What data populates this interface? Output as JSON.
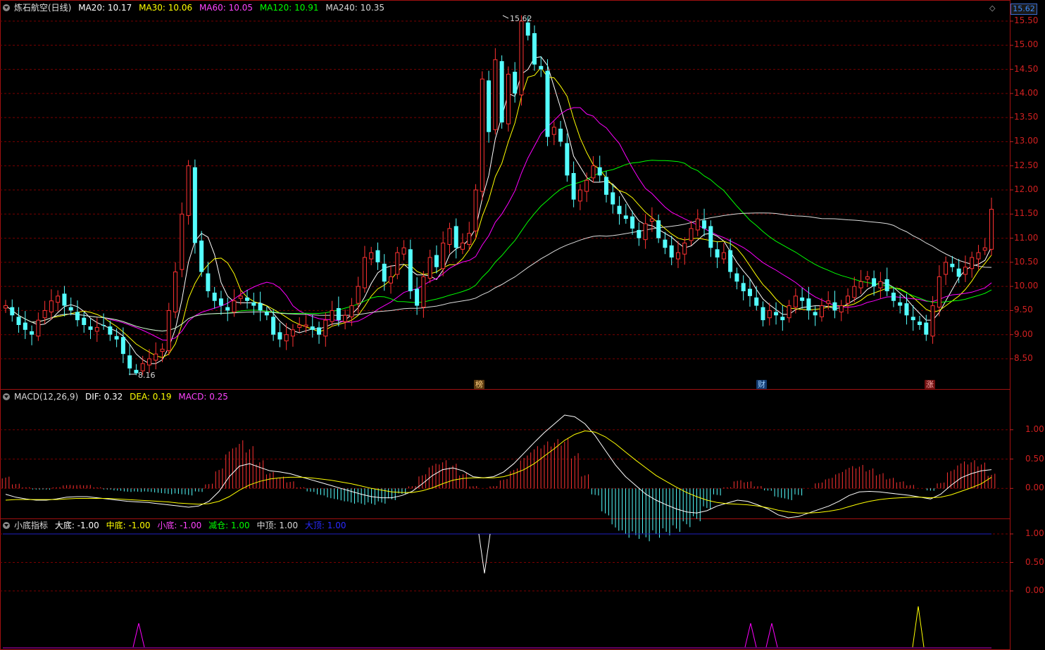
{
  "price_panel": {
    "title": "炼石航空(日线)",
    "ma": [
      {
        "label": "MA20: 10.17",
        "color": "#ffffff"
      },
      {
        "label": "MA30: 10.06",
        "color": "#ffff00"
      },
      {
        "label": "MA60: 10.05",
        "color": "#ff00ff"
      },
      {
        "label": "MA120: 10.91",
        "color": "#00ff00"
      },
      {
        "label": "MA240: 10.35",
        "color": "#dddddd"
      }
    ],
    "current_price": "15.62",
    "high_label": "15.62",
    "low_label": "8.16",
    "markers": [
      {
        "text": "榜",
        "bg": "#5a3a10",
        "color": "#ffd080"
      },
      {
        "text": "财",
        "bg": "#123a70",
        "color": "#9fd0ff"
      },
      {
        "text": "涨",
        "bg": "#701010",
        "color": "#ffb0b0"
      }
    ]
  },
  "macd_panel": {
    "name": "MACD(12,26,9)",
    "dif": "DIF: 0.32",
    "dea": "DEA: 0.19",
    "macd": "MACD: 0.25"
  },
  "bottom_panel": {
    "name": "小底指标",
    "items": [
      {
        "label": "大底: -1.00",
        "color": "#ffffff"
      },
      {
        "label": "中底: -1.00",
        "color": "#ffff00"
      },
      {
        "label": "小底: -1.00",
        "color": "#ff00ff"
      },
      {
        "label": "减仓: 1.00",
        "color": "#00ff00"
      },
      {
        "label": "中顶: 1.00",
        "color": "#dddddd"
      },
      {
        "label": "大顶: 1.00",
        "color": "#2020ff"
      }
    ]
  },
  "chart_data": [
    {
      "type": "candlestick",
      "title": "炼石航空(日线)",
      "ylim": [
        8.16,
        15.62
      ],
      "y_ticks": [
        "15.50",
        "15.00",
        "14.50",
        "14.00",
        "13.50",
        "13.00",
        "12.50",
        "12.00",
        "11.50",
        "11.00",
        "10.50",
        "10.00",
        "9.50",
        "9.00",
        "8.50"
      ],
      "high": 15.62,
      "low": 8.16,
      "close_series": [
        9.6,
        9.4,
        9.2,
        9.1,
        9.0,
        9.3,
        9.5,
        9.7,
        9.8,
        9.6,
        9.5,
        9.3,
        9.2,
        9.1,
        9.15,
        9.2,
        9.0,
        8.9,
        8.6,
        8.3,
        8.2,
        8.4,
        8.5,
        8.6,
        8.7,
        9.5,
        10.3,
        11.5,
        12.5,
        10.9,
        10.3,
        9.9,
        9.7,
        9.6,
        9.5,
        9.7,
        9.8,
        9.7,
        9.6,
        9.5,
        9.4,
        9.0,
        8.9,
        9.0,
        9.1,
        9.2,
        9.2,
        9.1,
        9.0,
        9.3,
        9.5,
        9.3,
        9.4,
        9.6,
        10.0,
        10.6,
        10.7,
        10.5,
        10.1,
        10.2,
        10.7,
        10.8,
        9.9,
        9.6,
        10.2,
        10.6,
        10.4,
        10.9,
        11.2,
        10.8,
        10.9,
        11.1,
        12.0,
        14.3,
        13.2,
        14.7,
        13.4,
        14.4,
        14.0,
        15.5,
        15.2,
        14.6,
        14.5,
        13.1,
        13.3,
        13.0,
        12.3,
        11.8,
        12.0,
        12.2,
        12.5,
        12.3,
        11.9,
        11.7,
        11.5,
        11.4,
        11.2,
        11.0,
        11.3,
        11.4,
        11.0,
        10.8,
        10.6,
        10.7,
        10.9,
        11.2,
        11.4,
        11.2,
        10.8,
        10.6,
        10.7,
        10.3,
        10.1,
        9.9,
        9.8,
        9.6,
        9.3,
        9.5,
        9.4,
        9.3,
        9.6,
        9.8,
        9.7,
        9.5,
        9.4,
        9.6,
        9.7,
        9.5,
        9.6,
        9.8,
        10.0,
        10.1,
        10.2,
        10.0,
        10.1,
        9.9,
        9.7,
        9.6,
        9.4,
        9.3,
        9.2,
        9.0,
        9.6,
        10.2,
        10.5,
        10.4,
        10.2,
        10.4,
        10.6,
        10.7,
        10.8,
        11.6
      ]
    },
    {
      "type": "bar",
      "title": "MACD(12,26,9)",
      "ylim": [
        -0.5,
        1.25
      ],
      "y_ticks": [
        "1.00",
        "0.50",
        "0.00"
      ],
      "series": [
        {
          "name": "DIF",
          "values": [
            -0.1,
            -0.15,
            -0.18,
            -0.2,
            -0.2,
            -0.18,
            -0.15,
            -0.14,
            -0.14,
            -0.16,
            -0.18,
            -0.2,
            -0.22,
            -0.23,
            -0.24,
            -0.26,
            -0.28,
            -0.3,
            -0.32,
            -0.3,
            -0.22,
            -0.05,
            0.2,
            0.38,
            0.42,
            0.36,
            0.3,
            0.28,
            0.25,
            0.2,
            0.15,
            0.1,
            0.05,
            0.0,
            -0.05,
            -0.1,
            -0.14,
            -0.16,
            -0.16,
            -0.12,
            -0.05,
            0.08,
            0.22,
            0.32,
            0.35,
            0.3,
            0.2,
            0.18,
            0.2,
            0.28,
            0.42,
            0.6,
            0.78,
            0.95,
            1.1,
            1.25,
            1.22,
            1.1,
            0.9,
            0.65,
            0.4,
            0.2,
            0.05,
            -0.1,
            -0.2,
            -0.28,
            -0.35,
            -0.4,
            -0.42,
            -0.38,
            -0.3,
            -0.25,
            -0.2,
            -0.22,
            -0.28,
            -0.35,
            -0.45,
            -0.5,
            -0.48,
            -0.42,
            -0.36,
            -0.3,
            -0.22,
            -0.12,
            -0.06,
            -0.05,
            -0.06,
            -0.08,
            -0.1,
            -0.12,
            -0.15,
            -0.18,
            -0.1,
            0.05,
            0.18,
            0.25,
            0.3,
            0.32
          ]
        },
        {
          "name": "DEA",
          "values": [
            -0.2,
            -0.19,
            -0.19,
            -0.19,
            -0.19,
            -0.19,
            -0.18,
            -0.17,
            -0.17,
            -0.17,
            -0.17,
            -0.18,
            -0.19,
            -0.2,
            -0.21,
            -0.22,
            -0.23,
            -0.25,
            -0.26,
            -0.27,
            -0.26,
            -0.22,
            -0.14,
            -0.03,
            0.06,
            0.12,
            0.16,
            0.18,
            0.19,
            0.19,
            0.18,
            0.16,
            0.14,
            0.11,
            0.08,
            0.04,
            0.0,
            -0.03,
            -0.06,
            -0.07,
            -0.07,
            -0.04,
            0.01,
            0.08,
            0.14,
            0.17,
            0.18,
            0.18,
            0.18,
            0.2,
            0.25,
            0.32,
            0.42,
            0.55,
            0.68,
            0.82,
            0.92,
            0.98,
            0.96,
            0.88,
            0.76,
            0.62,
            0.48,
            0.35,
            0.22,
            0.12,
            0.02,
            -0.07,
            -0.14,
            -0.2,
            -0.24,
            -0.26,
            -0.27,
            -0.28,
            -0.3,
            -0.33,
            -0.37,
            -0.4,
            -0.42,
            -0.42,
            -0.41,
            -0.39,
            -0.36,
            -0.31,
            -0.26,
            -0.22,
            -0.19,
            -0.17,
            -0.16,
            -0.15,
            -0.15,
            -0.16,
            -0.15,
            -0.11,
            -0.05,
            0.01,
            0.08,
            0.19
          ]
        },
        {
          "name": "MACD",
          "values": [
            0.2,
            0.08,
            0.02,
            -0.02,
            -0.02,
            0.02,
            0.06,
            0.06,
            0.06,
            0.02,
            -0.02,
            -0.04,
            -0.06,
            -0.06,
            -0.06,
            -0.08,
            -0.1,
            -0.1,
            -0.12,
            -0.06,
            0.08,
            0.34,
            0.68,
            0.82,
            0.72,
            0.48,
            0.28,
            0.2,
            0.12,
            0.02,
            -0.06,
            -0.12,
            -0.18,
            -0.22,
            -0.26,
            -0.28,
            -0.28,
            -0.26,
            -0.2,
            -0.1,
            0.04,
            0.24,
            0.42,
            0.48,
            0.42,
            0.26,
            0.04,
            0.0,
            0.04,
            0.16,
            0.34,
            0.56,
            0.72,
            0.8,
            0.84,
            0.86,
            0.6,
            0.24,
            -0.12,
            -0.46,
            -0.72,
            -0.84,
            -0.86,
            -0.9,
            -0.84,
            -0.8,
            -0.74,
            -0.66,
            -0.56,
            -0.36,
            -0.12,
            0.02,
            0.14,
            0.12,
            0.04,
            -0.04,
            -0.16,
            -0.2,
            -0.12,
            -0.0,
            0.1,
            0.18,
            0.28,
            0.38,
            0.4,
            0.34,
            0.26,
            0.18,
            0.12,
            0.06,
            0.0,
            -0.04,
            0.1,
            0.32,
            0.46,
            0.48,
            0.44,
            0.25
          ]
        }
      ]
    },
    {
      "type": "line",
      "title": "小底指标",
      "ylim": [
        -1.0,
        1.0
      ],
      "y_ticks": [
        "1.00",
        "0.50",
        "0.00"
      ],
      "series": [
        {
          "name": "大底",
          "values": [
            -1.0
          ]
        },
        {
          "name": "中底",
          "values": [
            -1.0
          ]
        },
        {
          "name": "小底",
          "values": [
            -1.0
          ]
        },
        {
          "name": "减仓",
          "values": [
            1.0
          ]
        },
        {
          "name": "中顶",
          "values": [
            1.0
          ]
        },
        {
          "name": "大顶",
          "values": [
            1.0
          ]
        }
      ]
    }
  ]
}
